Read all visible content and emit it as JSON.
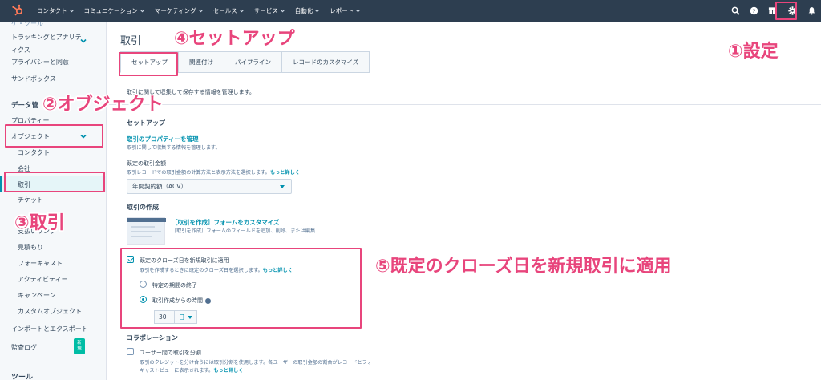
{
  "nav": {
    "items": [
      "コンタクト",
      "コミュニケーション",
      "マーケティング",
      "セールス",
      "サービス",
      "自動化",
      "レポート"
    ]
  },
  "sidebar": {
    "top_cut": "ゲ・ツール",
    "tracking": [
      "トラッキングとアナリテ",
      "ィクス"
    ],
    "privacy": "プライバシーと同意",
    "sandbox": "サンドボックス",
    "data_head": "データ管",
    "properties": "プロパティー",
    "objects": "オブジェクト",
    "sub_items": [
      "コンタクト",
      "会社",
      "取引",
      "チケット",
      "支払いリンク",
      "見積もり",
      "フォーキャスト",
      "アクティビティー",
      "キャンペーン",
      "カスタムオブジェクト"
    ],
    "import_export": "インポートとエクスポート",
    "audit_log": "監査ログ",
    "badge": [
      "新",
      "規"
    ],
    "tools_head": "ツール"
  },
  "main": {
    "title": "取引",
    "tabs": [
      "セットアップ",
      "関連付け",
      "パイプライン",
      "レコードのカスタマイズ"
    ],
    "description": "取引に関して収集して保存する情報を管理します。",
    "setup": {
      "title": "セットアップ",
      "link": "取引のプロパティーを管理",
      "link_desc": "取引に関して収集する情報を管理します。"
    },
    "amount": {
      "label": "既定の取引金額",
      "desc": "取引レコードでの取引金額の計算方法と表示方法を選択します。",
      "more": "もっと詳しく",
      "value": "年間契約額（ACV）"
    },
    "creation": {
      "title": "取引の作成",
      "link": "［取引を作成］フォームをカスタマイズ",
      "desc": "［取引を作成］フォームのフィールドを追加、削除、または編集"
    },
    "close_date": {
      "label": "既定のクローズ日を新規取引に適用",
      "desc": "取引を作成するときに既定のクローズ日を選択します。",
      "more": "もっと詳しく",
      "option1": "特定の期間の終了",
      "option2": "取引作成からの時間",
      "amount_value": "30",
      "unit": "日"
    },
    "collab": {
      "title": "コラボレーション",
      "label": "ユーザー間で取引を分割",
      "desc1": "取引のクレジットを分け合うには取引分割を使用します。各ユーザーの取引金額の割合がレコードとフォー",
      "desc2": "キャストビューに表示されます。",
      "more": "もっと詳しく"
    }
  },
  "annotations": {
    "a1": "①設定",
    "a2": "②オブジェクト",
    "a3": "③取引",
    "a4": "④セットアップ",
    "a5": "⑤既定のクローズ日を新規取引に適用"
  },
  "colors": {
    "accent": "#e8457c",
    "link": "#0091ae",
    "nav": "#2d3e50",
    "brand": "#ff7a59"
  }
}
